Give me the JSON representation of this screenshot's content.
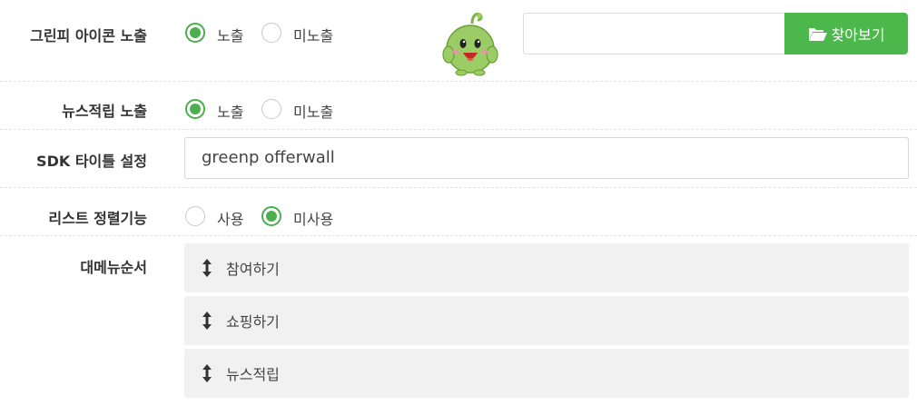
{
  "rows": {
    "icon_exposure": {
      "label": "그린피 아이콘 노출",
      "option_show": "노출",
      "option_hide": "미노출",
      "selected": "노출",
      "browse_label": "찾아보기"
    },
    "news_exposure": {
      "label": "뉴스적립 노출",
      "option_show": "노출",
      "option_hide": "미노출",
      "selected": "노출"
    },
    "sdk_title": {
      "label": "SDK 타이틀 설정",
      "value": "greenp offerwall"
    },
    "list_sort": {
      "label": "리스트 정렬기능",
      "option_use": "사용",
      "option_unuse": "미사용",
      "selected": "미사용"
    },
    "menu_order": {
      "label": "대메뉴순서",
      "items": [
        "참여하기",
        "쇼핑하기",
        "뉴스적립"
      ]
    }
  },
  "icons": {
    "mascot": "green-sprout-mascot-icon",
    "folder": "folder-open-icon",
    "sort": "vertical-arrows-icon"
  },
  "colors": {
    "accent": "#4cb84c",
    "radio_checked": "#4cae4c",
    "sort_item_bg": "#f1f1f1"
  }
}
